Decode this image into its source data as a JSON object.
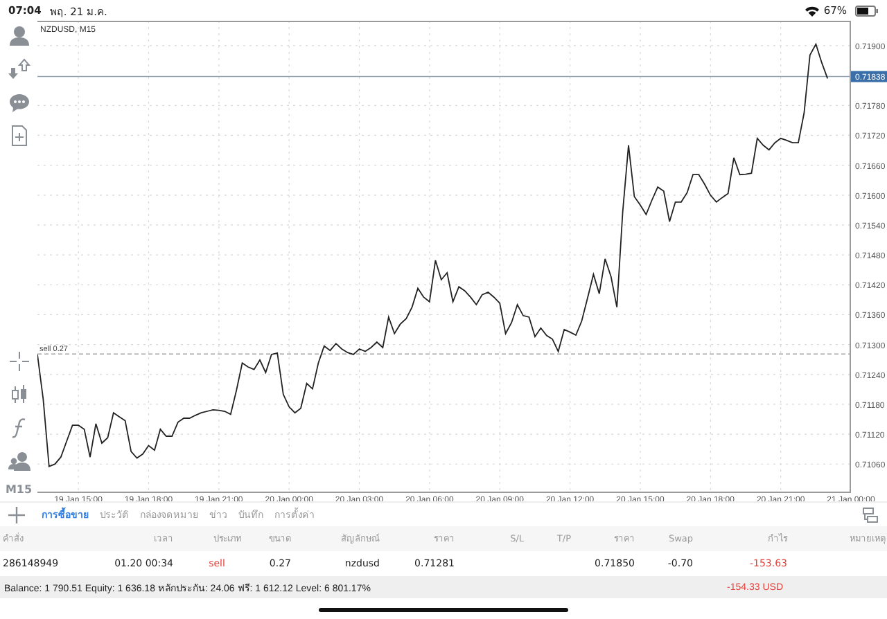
{
  "status_bar": {
    "time": "07:04",
    "date": "พฤ. 21 ม.ค.",
    "battery": "67%"
  },
  "toolbar": {
    "timeframe": "M15"
  },
  "chart": {
    "chart_data": {
      "type": "line",
      "title": "NZDUSD, M15",
      "categories": [
        null,
        null,
        null,
        null,
        null,
        null,
        null,
        "19 Jan 15:00",
        null,
        null,
        null,
        null,
        null,
        null,
        null,
        null,
        null,
        null,
        null,
        "19 Jan 18:00",
        null,
        null,
        null,
        null,
        null,
        null,
        null,
        null,
        null,
        null,
        null,
        "19 Jan 21:00",
        null,
        null,
        null,
        null,
        null,
        null,
        null,
        null,
        null,
        null,
        null,
        "20 Jan 00:00",
        null,
        null,
        null,
        null,
        null,
        null,
        null,
        null,
        null,
        null,
        null,
        "20 Jan 03:00",
        null,
        null,
        null,
        null,
        null,
        null,
        null,
        null,
        null,
        null,
        null,
        "20 Jan 06:00",
        null,
        null,
        null,
        null,
        null,
        null,
        null,
        null,
        null,
        null,
        null,
        "20 Jan 09:00",
        null,
        null,
        null,
        null,
        null,
        null,
        null,
        null,
        null,
        null,
        null,
        "20 Jan 12:00",
        null,
        null,
        null,
        null,
        null,
        null,
        null,
        null,
        null,
        null,
        null,
        "20 Jan 15:00",
        null,
        null,
        null,
        null,
        null,
        null,
        null,
        null,
        null,
        null,
        null,
        "20 Jan 18:00",
        null,
        null,
        null,
        null,
        null,
        null,
        null,
        null,
        null,
        null,
        null,
        "20 Jan 21:00",
        null,
        null,
        null,
        null,
        null,
        null,
        null,
        null,
        null,
        null,
        null,
        "21 Jan 00:00"
      ],
      "series": [
        {
          "color": "#222222",
          "values": [
            0.7128,
            0.7119,
            0.71055,
            0.7106,
            0.71074,
            0.71106,
            0.71138,
            0.71138,
            0.7113,
            0.71074,
            0.71141,
            0.71102,
            0.71113,
            0.71163,
            0.71155,
            0.71147,
            0.71085,
            0.71072,
            0.7108,
            0.71097,
            0.71088,
            0.7113,
            0.71116,
            0.71116,
            0.71144,
            0.71152,
            0.71152,
            0.71158,
            0.71163,
            0.71166,
            0.71169,
            0.71168,
            0.71166,
            0.7116,
            0.71208,
            0.71263,
            0.71255,
            0.7125,
            0.71269,
            0.71244,
            0.7128,
            0.71283,
            0.712,
            0.71175,
            0.71163,
            0.71172,
            0.71222,
            0.71211,
            0.71263,
            0.71297,
            0.71288,
            0.71302,
            0.71291,
            0.71284,
            0.7128,
            0.71291,
            0.71286,
            0.71294,
            0.71305,
            0.71294,
            0.71355,
            0.71322,
            0.71341,
            0.71352,
            0.71375,
            0.71413,
            0.71395,
            0.71386,
            0.71469,
            0.7143,
            0.71444,
            0.71386,
            0.71416,
            0.71408,
            0.71395,
            0.7138,
            0.714,
            0.71405,
            0.71395,
            0.71383,
            0.71322,
            0.71344,
            0.7138,
            0.71358,
            0.71355,
            0.71316,
            0.71333,
            0.71318,
            0.71311,
            0.71286,
            0.7133,
            0.71325,
            0.71319,
            0.71347,
            0.71394,
            0.71441,
            0.71402,
            0.71472,
            0.71436,
            0.71375,
            0.71566,
            0.717,
            0.71597,
            0.7158,
            0.71561,
            0.7159,
            0.71616,
            0.71608,
            0.71547,
            0.71586,
            0.71586,
            0.71605,
            0.71641,
            0.71641,
            0.71622,
            0.716,
            0.71586,
            0.71595,
            0.71603,
            0.71675,
            0.71641,
            0.71642,
            0.71644,
            0.71714,
            0.717,
            0.71691,
            0.71705,
            0.71714,
            0.7171,
            0.71705,
            0.71705,
            0.71765,
            0.71881,
            0.71903,
            0.71866,
            0.71834,
            null,
            null,
            null,
            null
          ]
        }
      ],
      "ylim": [
        0.71002,
        0.7195
      ],
      "yticks": [
        {
          "value": 0.7106,
          "label": "0.71060"
        },
        {
          "value": 0.7112,
          "label": "0.71120"
        },
        {
          "value": 0.7118,
          "label": "0.71180"
        },
        {
          "value": 0.7124,
          "label": "0.71240"
        },
        {
          "value": 0.713,
          "label": "0.71300"
        },
        {
          "value": 0.7136,
          "label": "0.71360"
        },
        {
          "value": 0.7142,
          "label": "0.71420"
        },
        {
          "value": 0.7148,
          "label": "0.71480"
        },
        {
          "value": 0.7154,
          "label": "0.71540"
        },
        {
          "value": 0.716,
          "label": "0.71600"
        },
        {
          "value": 0.7166,
          "label": "0.71660"
        },
        {
          "value": 0.7172,
          "label": "0.71720"
        },
        {
          "value": 0.7178,
          "label": "0.71780"
        },
        {
          "value": 0.719,
          "label": "0.71900"
        }
      ],
      "grid": true,
      "ref_lines": [
        {
          "axis": "y",
          "value": 0.71838,
          "label": "0.71838"
        },
        {
          "axis": "y",
          "value": 0.71281,
          "label": "sell 0.27"
        }
      ]
    }
  },
  "tabs": [
    {
      "label": "การซื้อขาย",
      "selected": true
    },
    {
      "label": "ประวัติ",
      "selected": false
    },
    {
      "label": "กล่องจดหมาย",
      "selected": false
    },
    {
      "label": "ข่าว",
      "selected": false
    },
    {
      "label": "บันทึก",
      "selected": false
    },
    {
      "label": "การตั้งค่า",
      "selected": false
    }
  ],
  "table": {
    "columns": [
      "คำสั่ง",
      "เวลา",
      "ประเภท",
      "ขนาด",
      "สัญลักษณ์",
      "ราคา",
      "S/L",
      "T/P",
      "ราคา",
      "Swap",
      "กำไร",
      "หมายเหตุ"
    ],
    "rows": [
      {
        "cells": [
          {
            "text": "286148949"
          },
          {
            "text": "01.20 00:34"
          },
          {
            "text": "sell",
            "color": "#e5413b"
          },
          {
            "text": "0.27"
          },
          {
            "text": "nzdusd"
          },
          {
            "text": "0.71281"
          },
          {
            "text": ""
          },
          {
            "text": ""
          },
          {
            "text": "0.71850"
          },
          {
            "text": "-0.70"
          },
          {
            "text": "-153.63",
            "color": "#e5413b"
          },
          {
            "text": ""
          }
        ]
      }
    ]
  },
  "summary": {
    "text": "Balance: 1 790.51 Equity: 1 636.18 หลักประกัน: 24.06 ฟรี: 1 612.12 Level: 6 801.17%",
    "total": {
      "text": "-154.33  USD",
      "color": "#e5413b"
    }
  }
}
